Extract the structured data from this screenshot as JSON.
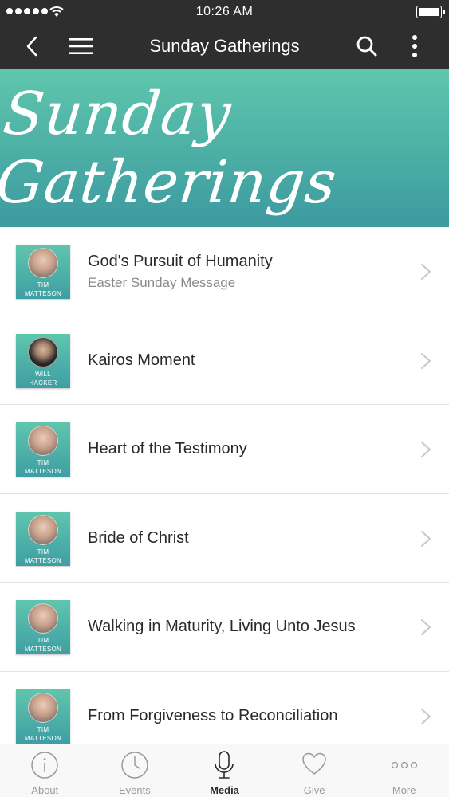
{
  "status_bar": {
    "time": "10:26 AM"
  },
  "nav": {
    "title": "Sunday Gatherings"
  },
  "banner": {
    "text": "Sunday Gatherings"
  },
  "items": [
    {
      "title": "God's Pursuit of Humanity",
      "subtitle": "Easter Sunday Message",
      "speaker_line1": "TIM",
      "speaker_line2": "MATTESON"
    },
    {
      "title": "Kairos Moment",
      "subtitle": "",
      "speaker_line1": "WILL",
      "speaker_line2": "HACKER"
    },
    {
      "title": "Heart of the Testimony",
      "subtitle": "",
      "speaker_line1": "TIM",
      "speaker_line2": "MATTESON"
    },
    {
      "title": "Bride of Christ",
      "subtitle": "",
      "speaker_line1": "TIM",
      "speaker_line2": "MATTESON"
    },
    {
      "title": "Walking in Maturity, Living Unto Jesus",
      "subtitle": "",
      "speaker_line1": "TIM",
      "speaker_line2": "MATTESON"
    },
    {
      "title": "From Forgiveness to Reconciliation",
      "subtitle": "",
      "speaker_line1": "TIM",
      "speaker_line2": "MATTESON"
    }
  ],
  "tabs": [
    {
      "label": "About",
      "icon": "info-icon"
    },
    {
      "label": "Events",
      "icon": "clock-icon"
    },
    {
      "label": "Media",
      "icon": "microphone-icon",
      "active": true
    },
    {
      "label": "Give",
      "icon": "heart-icon"
    },
    {
      "label": "More",
      "icon": "more-dots-icon"
    }
  ],
  "colors": {
    "bar": "#2e2e2e",
    "accent_top": "#5fc6ad",
    "accent_bottom": "#3d9aa0"
  }
}
